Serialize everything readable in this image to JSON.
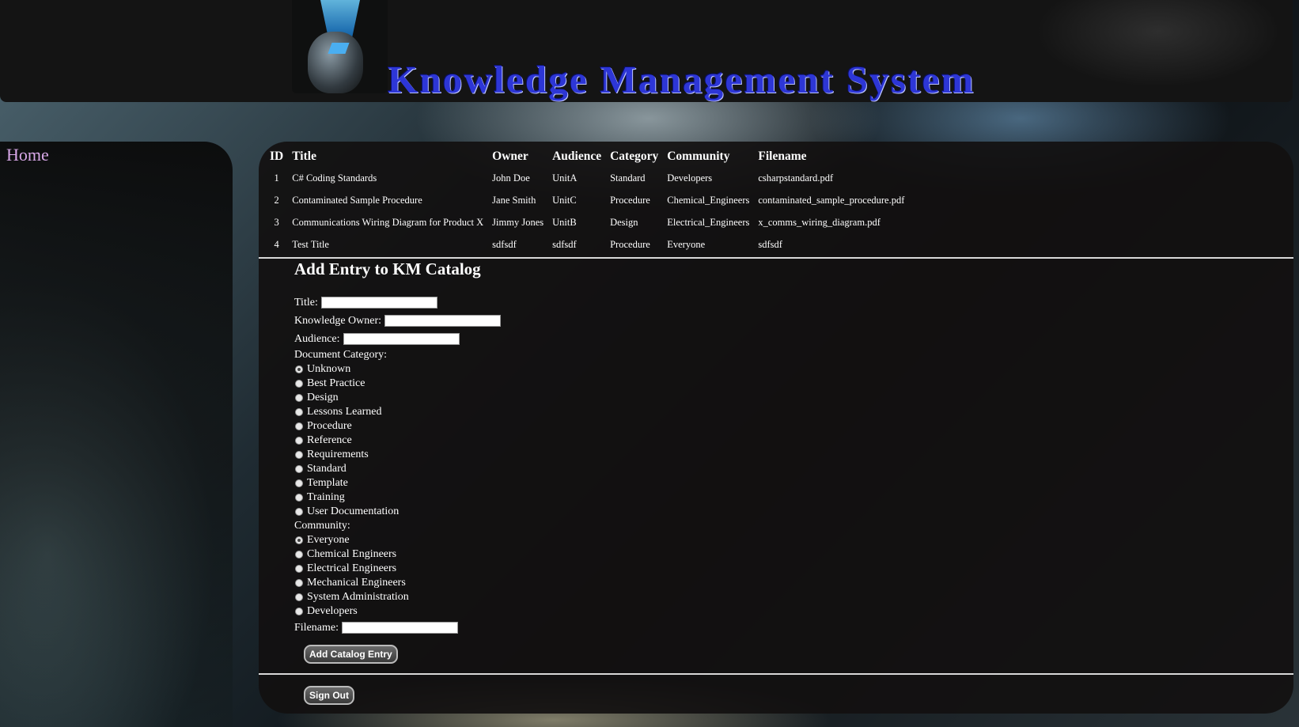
{
  "header": {
    "title": "Knowledge Management System"
  },
  "nav": {
    "home": "Home"
  },
  "catalog": {
    "columns": [
      "ID",
      "Title",
      "Owner",
      "Audience",
      "Category",
      "Community",
      "Filename"
    ],
    "rows": [
      {
        "id": "1",
        "title": "C# Coding Standards",
        "owner": "John Doe",
        "audience": "UnitA",
        "category": "Standard",
        "community": "Developers",
        "filename": "csharpstandard.pdf"
      },
      {
        "id": "2",
        "title": "Contaminated Sample Procedure",
        "owner": "Jane Smith",
        "audience": "UnitC",
        "category": "Procedure",
        "community": "Chemical_Engineers",
        "filename": "contaminated_sample_procedure.pdf"
      },
      {
        "id": "3",
        "title": "Communications Wiring Diagram for Product X",
        "owner": "Jimmy Jones",
        "audience": "UnitB",
        "category": "Design",
        "community": "Electrical_Engineers",
        "filename": "x_comms_wiring_diagram.pdf"
      },
      {
        "id": "4",
        "title": "Test Title",
        "owner": "sdfsdf",
        "audience": "sdfsdf",
        "category": "Procedure",
        "community": "Everyone",
        "filename": "sdfsdf"
      }
    ]
  },
  "form": {
    "heading": "Add Entry to KM Catalog",
    "title_label": "Title:",
    "title_value": "",
    "owner_label": "Knowledge Owner:",
    "owner_value": "",
    "audience_label": "Audience:",
    "audience_value": "",
    "category_label": "Document Category:",
    "categories": [
      "Unknown",
      "Best Practice",
      "Design",
      "Lessons Learned",
      "Procedure",
      "Reference",
      "Requirements",
      "Standard",
      "Template",
      "Training",
      "User Documentation"
    ],
    "category_selected": "Unknown",
    "community_label": "Community:",
    "communities": [
      "Everyone",
      "Chemical Engineers",
      "Electrical Engineers",
      "Mechanical Engineers",
      "System Administration",
      "Developers"
    ],
    "community_selected": "Everyone",
    "filename_label": "Filename:",
    "filename_value": "",
    "submit_label": "Add Catalog Entry"
  },
  "signout_label": "Sign Out",
  "colors": {
    "title_blue": "#2d36d6",
    "home_link": "#d8a8e8",
    "panel": "#121010"
  }
}
